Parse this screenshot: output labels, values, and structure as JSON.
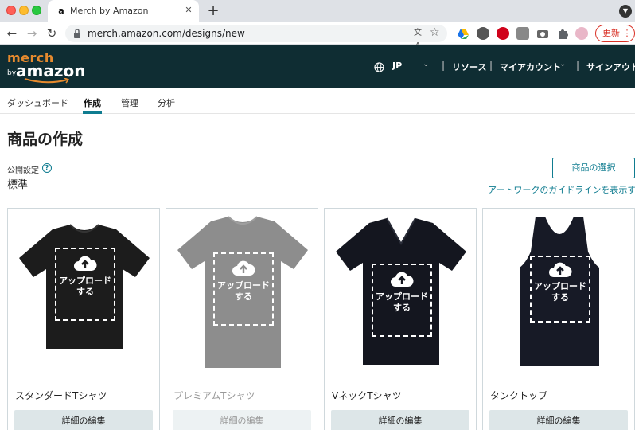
{
  "browser": {
    "tab_title": "Merch by Amazon",
    "tab_favicon": "a",
    "url": "merch.amazon.com/designs/new",
    "update_label": "更新",
    "translate_glyph": "文A"
  },
  "header": {
    "logo_merch": "merch",
    "logo_by": "by",
    "logo_amazon": "amazon",
    "region": "JP",
    "resources": "リソース",
    "account": "マイアカウント",
    "signout": "サインアウト",
    "separator": "|"
  },
  "subnav": {
    "dashboard": "ダッシュボード",
    "create": "作成",
    "manage": "管理",
    "analyze": "分析"
  },
  "page": {
    "title": "商品の作成",
    "visibility_label": "公開設定",
    "visibility_value": "標準",
    "help_glyph": "?",
    "select_products": "商品の選択",
    "guidelines_link": "アートワークのガイドラインを表示する"
  },
  "products": [
    {
      "title": "スタンダードTシャツ",
      "upload_line1": "アップロード",
      "upload_line2": "する",
      "edit": "詳細の編集",
      "color": "#1c1c1c"
    },
    {
      "title": "プレミアムTシャツ",
      "upload_line1": "アップロード",
      "upload_line2": "する",
      "edit": "詳細の編集",
      "color": "#8d8d8d"
    },
    {
      "title": "VネックTシャツ",
      "upload_line1": "アップロード",
      "upload_line2": "する",
      "edit": "詳細の編集",
      "color": "#14161f"
    },
    {
      "title": "タンクトップ",
      "upload_line1": "アップロード",
      "upload_line2": "する",
      "edit": "詳細の編集",
      "color": "#171a26"
    }
  ],
  "icons": [
    "globe-icon",
    "chevron-down-icon",
    "upload-cloud-icon",
    "help-icon",
    "lock-icon",
    "star-icon"
  ],
  "colors": {
    "header_bg": "#0f2d33",
    "accent": "#0f7c90",
    "logo_orange": "#e68a2e"
  }
}
